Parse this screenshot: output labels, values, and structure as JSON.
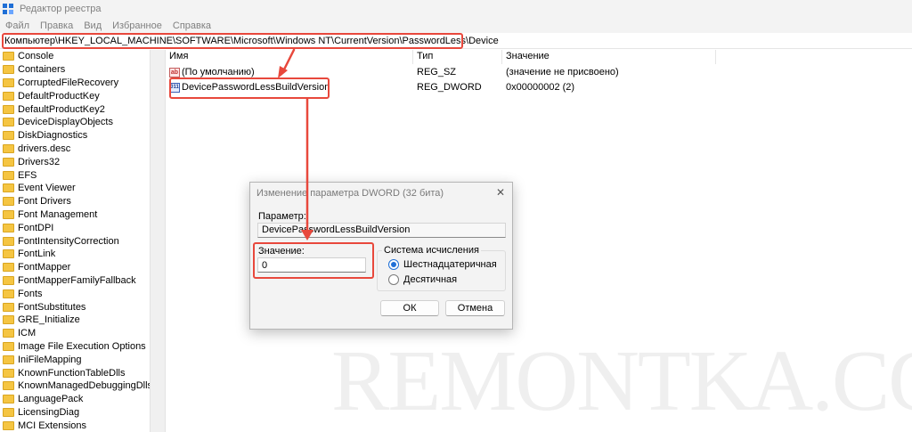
{
  "window": {
    "title": "Редактор реестра"
  },
  "menu": [
    "Файл",
    "Правка",
    "Вид",
    "Избранное",
    "Справка"
  ],
  "address": {
    "path": "Компьютер\\HKEY_LOCAL_MACHINE\\SOFTWARE\\Microsoft\\Windows NT\\CurrentVersion\\PasswordLess\\Device"
  },
  "tree": {
    "items": [
      "Console",
      "Containers",
      "CorruptedFileRecovery",
      "DefaultProductKey",
      "DefaultProductKey2",
      "DeviceDisplayObjects",
      "DiskDiagnostics",
      "drivers.desc",
      "Drivers32",
      "EFS",
      "Event Viewer",
      "Font Drivers",
      "Font Management",
      "FontDPI",
      "FontIntensityCorrection",
      "FontLink",
      "FontMapper",
      "FontMapperFamilyFallback",
      "Fonts",
      "FontSubstitutes",
      "GRE_Initialize",
      "ICM",
      "Image File Execution Options",
      "IniFileMapping",
      "KnownFunctionTableDlls",
      "KnownManagedDebuggingDlls",
      "LanguagePack",
      "LicensingDiag",
      "MCI Extensions"
    ]
  },
  "list": {
    "headers": {
      "name": "Имя",
      "type": "Тип",
      "value": "Значение"
    },
    "rows": [
      {
        "icon": "string-value-icon",
        "icon_text": "ab",
        "name": "(По умолчанию)",
        "type": "REG_SZ",
        "value": "(значение не присвоено)"
      },
      {
        "icon": "binary-value-icon",
        "icon_text": "011",
        "name": "DevicePasswordLessBuildVersion",
        "type": "REG_DWORD",
        "value": "0x00000002 (2)"
      }
    ]
  },
  "dialog": {
    "title": "Изменение параметра DWORD (32 бита)",
    "close": "✕",
    "param_label": "Параметр:",
    "param_value": "DevicePasswordLessBuildVersion",
    "value_label": "Значение:",
    "value": "0",
    "base_group": "Система исчисления",
    "hex_label": "Шестнадцатеричная",
    "dec_label": "Десятичная",
    "selected_base": "hex",
    "ok_label": "ОК",
    "cancel_label": "Отмена"
  },
  "watermark": "REMONTKA.COM",
  "colors": {
    "highlight": "#e8483c",
    "folder": "#f5c542",
    "accent": "#1f6fd6"
  }
}
